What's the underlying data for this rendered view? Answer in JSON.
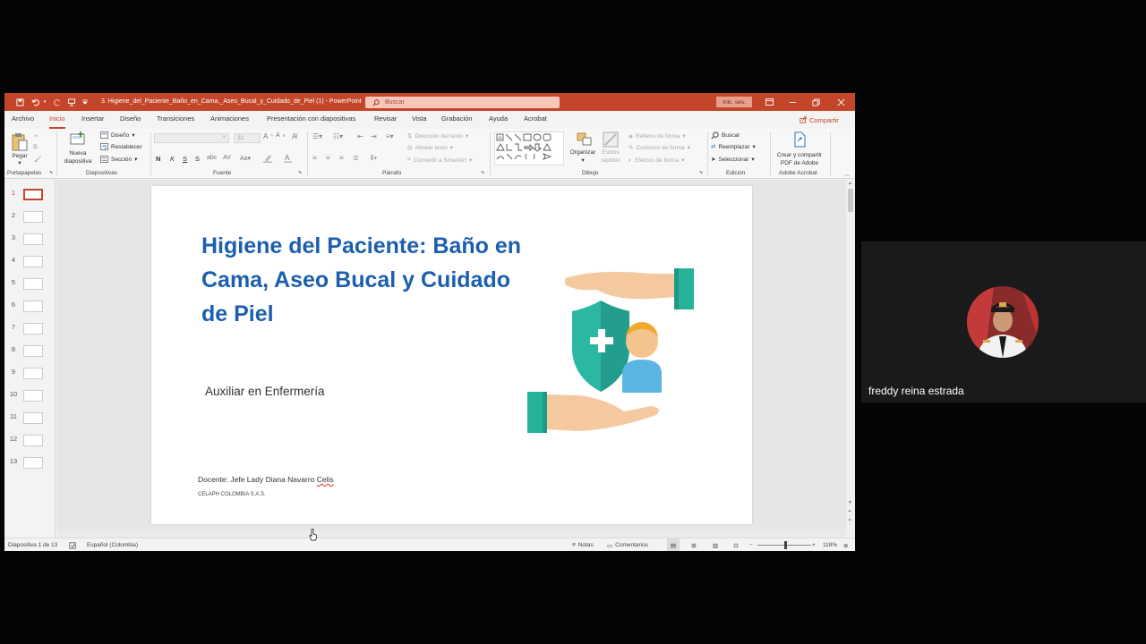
{
  "titlebar": {
    "doc_title": "3. Higiene_del_Paciente_Baño_en_Cama,_Aseo_Bucal_y_Cuidado_de_Piel (1)  -  PowerPoint",
    "search_placeholder": "Buscar",
    "signin_label": "Inic. ses.",
    "color": "#c4462a"
  },
  "tabs": [
    {
      "label": "Archivo"
    },
    {
      "label": "Inicio"
    },
    {
      "label": "Insertar"
    },
    {
      "label": "Diseño"
    },
    {
      "label": "Transiciones"
    },
    {
      "label": "Animaciones"
    },
    {
      "label": "Presentación con diapositivas"
    },
    {
      "label": "Revisar"
    },
    {
      "label": "Vista"
    },
    {
      "label": "Grabación"
    },
    {
      "label": "Ayuda"
    },
    {
      "label": "Acrobat"
    }
  ],
  "share_label": "Compartir",
  "ribbon": {
    "clipboard": {
      "paste": "Pegar",
      "group": "Portapapeles"
    },
    "slides": {
      "new_slide_line1": "Nueva",
      "new_slide_line2": "diapositiva",
      "layout": "Diseño",
      "reset": "Restablecer",
      "section": "Sección",
      "group": "Diapositivas"
    },
    "font": {
      "font_size": "32",
      "bold": "N",
      "italic": "K",
      "underline": "S",
      "strike": "S",
      "group": "Fuente"
    },
    "paragraph": {
      "text_direction": "Dirección del texto",
      "align_text": "Alinear texto",
      "smartart": "Convertir a SmartArt",
      "group": "Párrafo"
    },
    "drawing": {
      "arrange": "Organizar",
      "quick_styles_line1": "Estilos",
      "quick_styles_line2": "rápidos",
      "fill": "Relleno de forma",
      "outline": "Contorno de forma",
      "effects": "Efectos de forma",
      "group": "Dibujo"
    },
    "editing": {
      "find": "Buscar",
      "replace": "Reemplazar",
      "select": "Seleccionar",
      "group": "Edición"
    },
    "acrobat": {
      "create_line1": "Crear y compartir",
      "create_line2": "PDF de Adobe",
      "group": "Adobe Acrobat"
    }
  },
  "thumbnails": [
    "1",
    "2",
    "3",
    "4",
    "5",
    "6",
    "7",
    "8",
    "9",
    "10",
    "11",
    "12",
    "13"
  ],
  "slide": {
    "title": "Higiene del Paciente: Baño en Cama, Aseo Bucal y Cuidado de Piel",
    "subtitle": "Auxiliar en Enfermería",
    "teacher_prefix": "Docente: Jefe Lady Diana Navarro ",
    "teacher_underlined": "Celis",
    "organization": "CELAPH COLOMBIA S.A.S."
  },
  "statusbar": {
    "slide_counter": "Diapositiva 1 de 13",
    "language": "Español (Colombia)",
    "notes": "Notas",
    "comments": "Comentarios",
    "zoom": "118%"
  },
  "participant": {
    "name": "freddy reina estrada"
  }
}
